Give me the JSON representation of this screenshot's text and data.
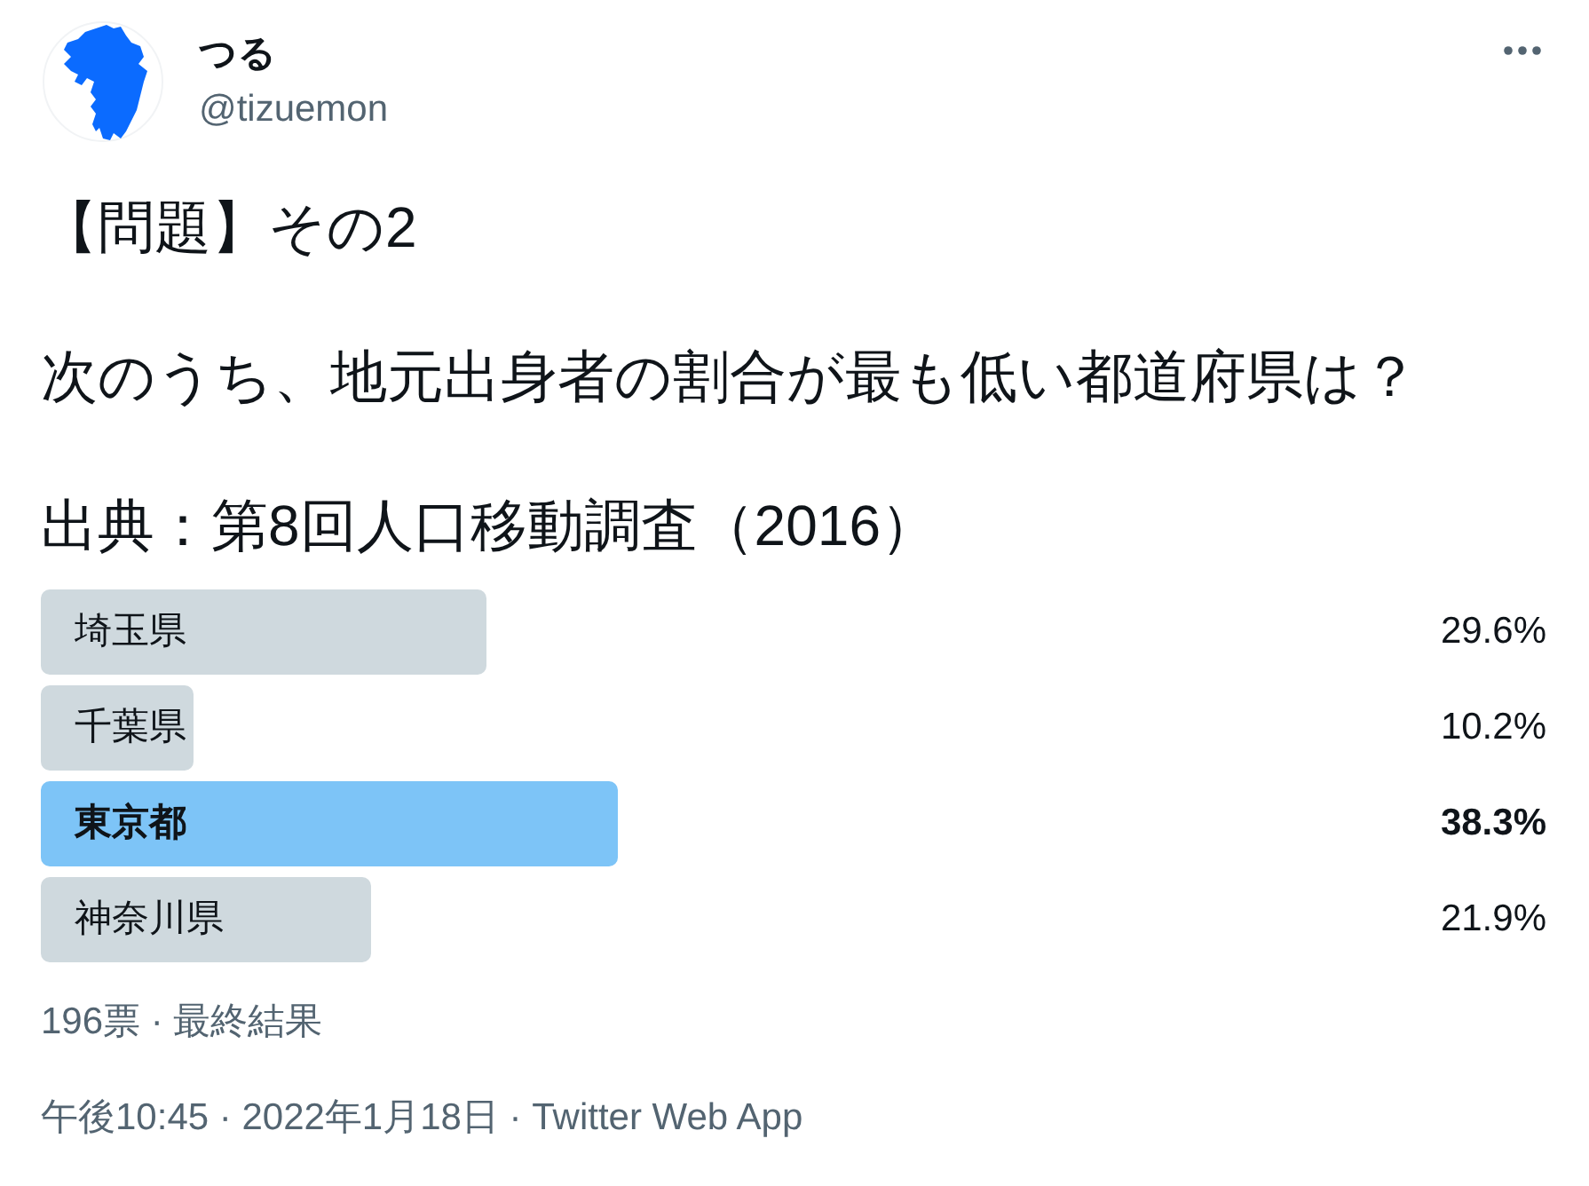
{
  "author": {
    "display_name": "つる",
    "handle": "@tizuemon"
  },
  "tweet_text": [
    "【問題】その2",
    "次のうち、地元出身者の割合が最も低い都道府県は？",
    "出典：第8回人口移動調査（2016）"
  ],
  "poll": {
    "options": [
      {
        "label": "埼玉県",
        "percent": "29.6%",
        "level": 0.296,
        "winner": false
      },
      {
        "label": "千葉県",
        "percent": "10.2%",
        "level": 0.102,
        "winner": false
      },
      {
        "label": "東京都",
        "percent": "38.3%",
        "level": 0.383,
        "winner": true
      },
      {
        "label": "神奈川県",
        "percent": "21.9%",
        "level": 0.219,
        "winner": false
      }
    ],
    "summary": "196票 · 最終結果"
  },
  "timestamp": "午後10:45 · 2022年1月18日 · Twitter Web App"
}
